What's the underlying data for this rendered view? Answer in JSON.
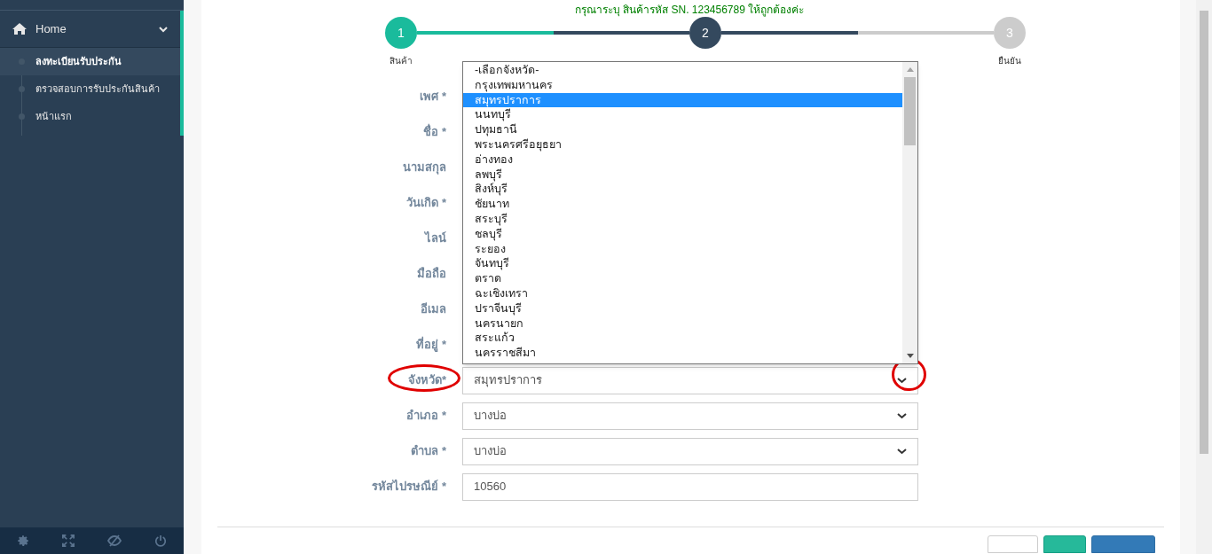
{
  "sidebar": {
    "menu": {
      "label": "Home",
      "expanded": true,
      "children": [
        {
          "label": "ลงทะเบียนรับประกัน",
          "selected": true
        },
        {
          "label": "ตรวจสอบการรับประกันสินค้า",
          "selected": false
        },
        {
          "label": "หน้าแรก",
          "selected": false
        }
      ]
    }
  },
  "message": "กรุณาระบุ สินค้ารหัส SN. 123456789 ให้ถูกต้องค่ะ",
  "steps": [
    {
      "number": "1",
      "label": "สินค้า",
      "done": true,
      "current": false
    },
    {
      "number": "2",
      "done": false,
      "current": true
    },
    {
      "number": "3",
      "label": "ยืนยัน",
      "done": false,
      "current": false
    }
  ],
  "form": {
    "fields": [
      {
        "label": "เพศ *",
        "kind": "covered"
      },
      {
        "label": "ชื่อ *",
        "kind": "covered"
      },
      {
        "label": "นามสกุล",
        "kind": "covered"
      },
      {
        "label": "วันเกิด *",
        "kind": "covered"
      },
      {
        "label": "ไลน์",
        "kind": "covered"
      },
      {
        "label": "มือถือ",
        "kind": "covered"
      },
      {
        "label": "อีเมล",
        "kind": "covered"
      },
      {
        "label": "ที่อยู่ *",
        "kind": "covered"
      },
      {
        "label": "จังหวัด*",
        "kind": "select",
        "value": "สมุทรปราการ",
        "marked": true
      },
      {
        "label": "อำเภอ *",
        "kind": "select",
        "value": "บางบ่อ",
        "marked": false
      },
      {
        "label": "ตำบล *",
        "kind": "select",
        "value": "บางบ่อ",
        "marked": false
      },
      {
        "label": "รหัสไปรษณีย์ *",
        "kind": "text",
        "value": "10560",
        "marked": false
      }
    ]
  },
  "dropdown": {
    "options": [
      {
        "label": "-เลือกจังหวัด-",
        "selected": false
      },
      {
        "label": "กรุงเทพมหานคร",
        "selected": false
      },
      {
        "label": "สมุทรปราการ",
        "selected": true
      },
      {
        "label": "นนทบุรี",
        "selected": false
      },
      {
        "label": "ปทุมธานี",
        "selected": false
      },
      {
        "label": "พระนครศรีอยุธยา",
        "selected": false
      },
      {
        "label": "อ่างทอง",
        "selected": false
      },
      {
        "label": "ลพบุรี",
        "selected": false
      },
      {
        "label": "สิงห์บุรี",
        "selected": false
      },
      {
        "label": "ชัยนาท",
        "selected": false
      },
      {
        "label": "สระบุรี",
        "selected": false
      },
      {
        "label": "ชลบุรี",
        "selected": false
      },
      {
        "label": "ระยอง",
        "selected": false
      },
      {
        "label": "จันทบุรี",
        "selected": false
      },
      {
        "label": "ตราด",
        "selected": false
      },
      {
        "label": "ฉะเชิงเทรา",
        "selected": false
      },
      {
        "label": "ปราจีนบุรี",
        "selected": false
      },
      {
        "label": "นครนายก",
        "selected": false
      },
      {
        "label": "สระแก้ว",
        "selected": false
      },
      {
        "label": "นครราชสีมา",
        "selected": false
      }
    ]
  },
  "buttons": [
    {
      "kind": "default"
    },
    {
      "kind": "success"
    },
    {
      "kind": "primary"
    }
  ]
}
